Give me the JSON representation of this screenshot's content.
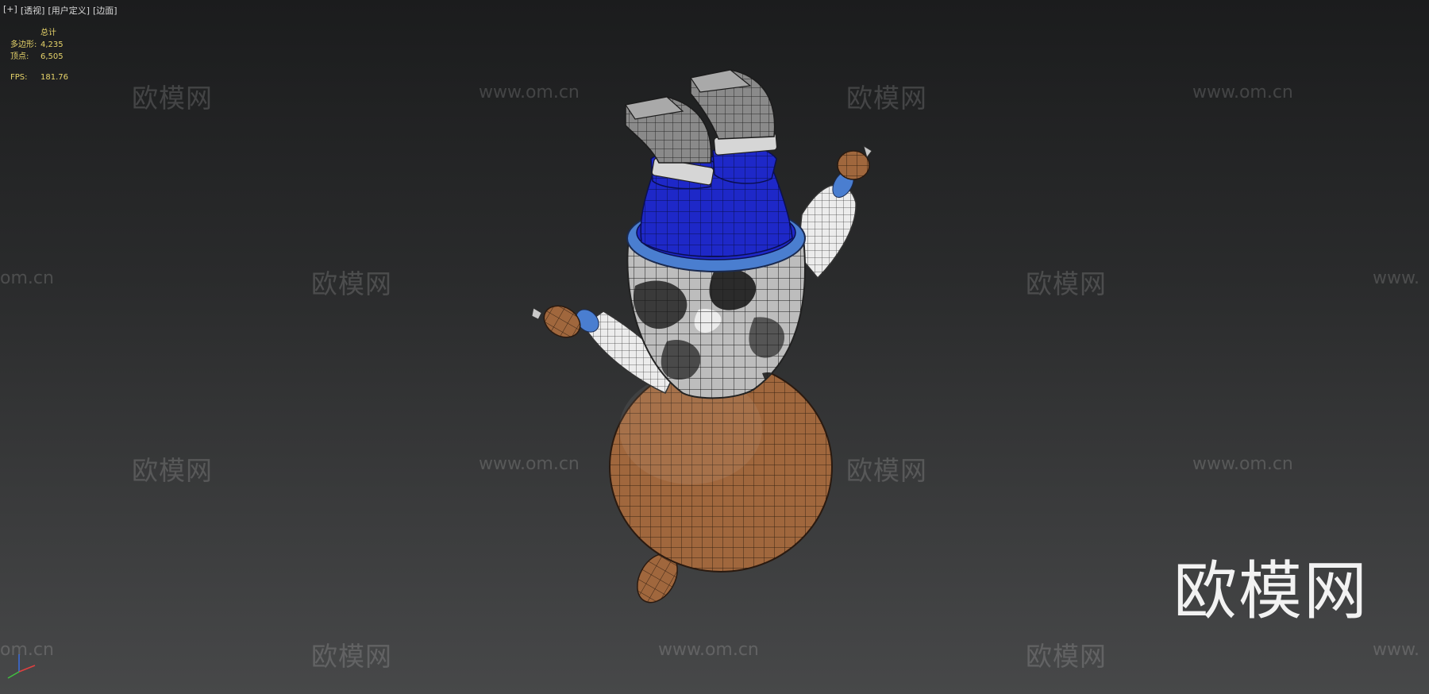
{
  "viewport_menu": [
    "[+]",
    "[透视]",
    "[用户定义]",
    "[边面]"
  ],
  "stats": {
    "header": "总计",
    "polygons_label": "多边形:",
    "polygons_value": "4,235",
    "vertices_label": "顶点:",
    "vertices_value": "6,505",
    "fps_label": "FPS:",
    "fps_value": "181.76"
  },
  "watermark": {
    "brand": "欧模网",
    "url": "www.om.cn",
    "url_partial_left": "om.cn",
    "url_partial_right": "www."
  },
  "colors": {
    "bg_top": "#1b1c1d",
    "bg_bottom": "#474849",
    "stats_text": "#e6d36a",
    "pants_blue": "#1e28c8",
    "belt_blue": "#4a7ed0",
    "head_brown": "#a0673d",
    "boot_gray": "#7f7f7f",
    "sleeve_white": "#e8e8e8"
  }
}
